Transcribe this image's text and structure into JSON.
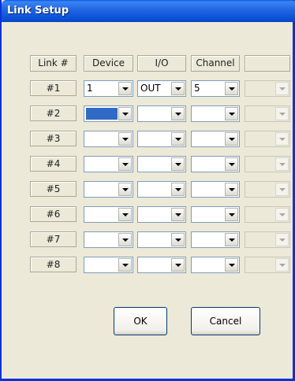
{
  "window": {
    "title": "Link Setup"
  },
  "headers": {
    "link": "Link #",
    "device": "Device",
    "io": "I/O",
    "channel": "Channel",
    "extra": ""
  },
  "rows": [
    {
      "label": "#1",
      "device": "1",
      "io": "OUT",
      "channel": "5"
    },
    {
      "label": "#2",
      "device": "",
      "io": "",
      "channel": ""
    },
    {
      "label": "#3",
      "device": "",
      "io": "",
      "channel": ""
    },
    {
      "label": "#4",
      "device": "",
      "io": "",
      "channel": ""
    },
    {
      "label": "#5",
      "device": "",
      "io": "",
      "channel": ""
    },
    {
      "label": "#6",
      "device": "",
      "io": "",
      "channel": ""
    },
    {
      "label": "#7",
      "device": "",
      "io": "",
      "channel": ""
    },
    {
      "label": "#8",
      "device": "",
      "io": "",
      "channel": ""
    }
  ],
  "selected_cell": {
    "row": 2,
    "column": "device"
  },
  "buttons": {
    "ok": "OK",
    "cancel": "Cancel"
  },
  "icons": {
    "dropdown": "chevron-down-icon"
  },
  "colors": {
    "titlebar": "#0A4FD6",
    "dialog_bg": "#ECE9D8",
    "selection": "#316AC5"
  }
}
